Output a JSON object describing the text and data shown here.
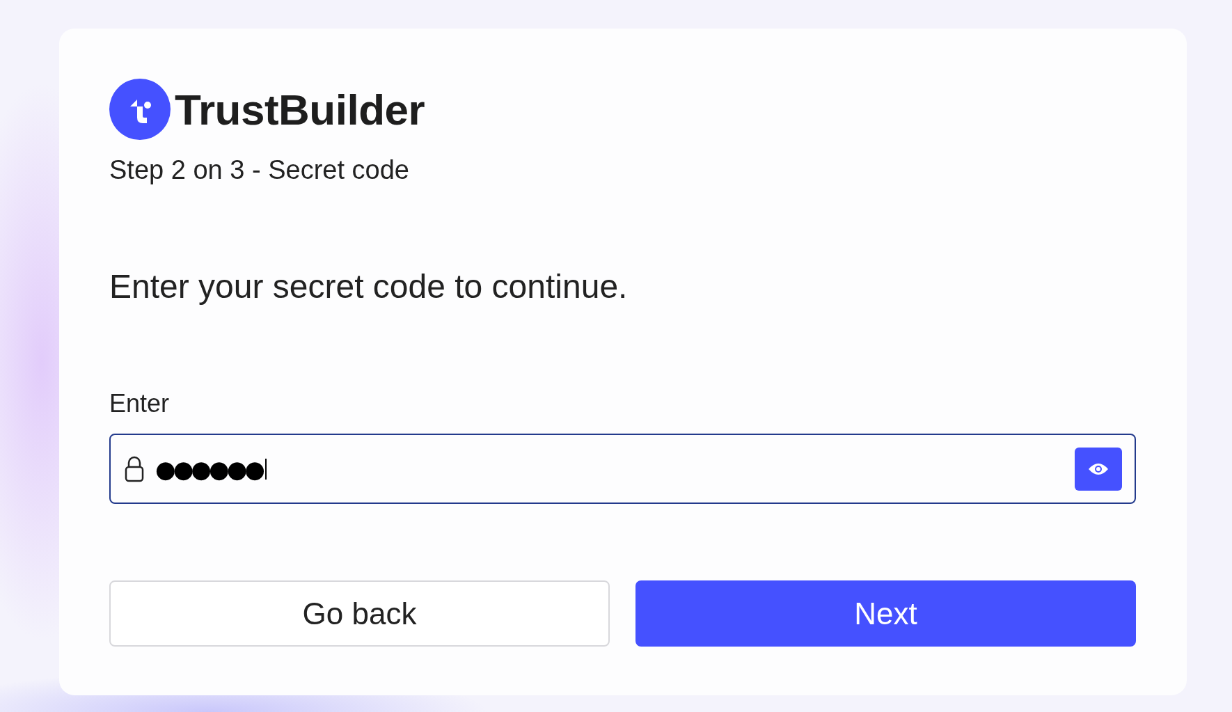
{
  "logo": {
    "text": "TrustBuilder"
  },
  "step": "Step 2 on 3 - Secret code",
  "prompt": "Enter your secret code to continue.",
  "field": {
    "label": "Enter",
    "value": "●●●●●●",
    "focused": true
  },
  "buttons": [
    {
      "label": "Go back",
      "kind": "secondary"
    },
    {
      "label": "Next",
      "kind": "primary"
    }
  ]
}
